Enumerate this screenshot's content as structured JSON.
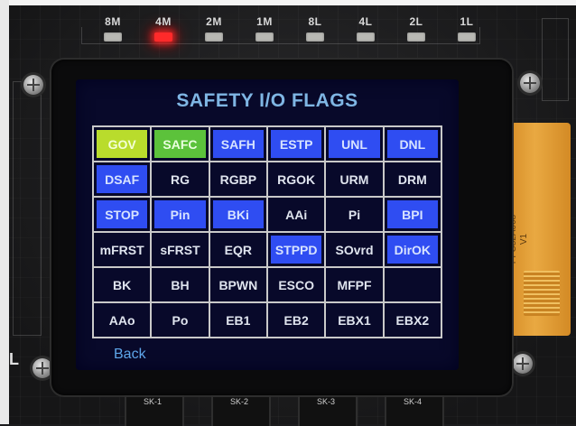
{
  "leds": [
    {
      "label": "8M",
      "on": false
    },
    {
      "label": "4M",
      "on": true
    },
    {
      "label": "2M",
      "on": false
    },
    {
      "label": "1M",
      "on": false
    },
    {
      "label": "8L",
      "on": false
    },
    {
      "label": "4L",
      "on": false
    },
    {
      "label": "2L",
      "on": false
    },
    {
      "label": "1L",
      "on": false
    }
  ],
  "screen": {
    "title": "SAFETY I/O FLAGS",
    "back_label": "Back",
    "flags": [
      [
        {
          "label": "GOV",
          "state": "yellowgreen"
        },
        {
          "label": "SAFC",
          "state": "green"
        },
        {
          "label": "SAFH",
          "state": "blue"
        },
        {
          "label": "ESTP",
          "state": "blue"
        },
        {
          "label": "UNL",
          "state": "blue"
        },
        {
          "label": "DNL",
          "state": "blue"
        }
      ],
      [
        {
          "label": "DSAF",
          "state": "blue"
        },
        {
          "label": "RG",
          "state": "dark"
        },
        {
          "label": "RGBP",
          "state": "dark"
        },
        {
          "label": "RGOK",
          "state": "dark"
        },
        {
          "label": "URM",
          "state": "dark"
        },
        {
          "label": "DRM",
          "state": "dark"
        }
      ],
      [
        {
          "label": "STOP",
          "state": "blue"
        },
        {
          "label": "Pin",
          "state": "blue"
        },
        {
          "label": "BKi",
          "state": "blue"
        },
        {
          "label": "AAi",
          "state": "dark"
        },
        {
          "label": "Pi",
          "state": "dark"
        },
        {
          "label": "BPI",
          "state": "blue"
        }
      ],
      [
        {
          "label": "mFRST",
          "state": "dark"
        },
        {
          "label": "sFRST",
          "state": "dark"
        },
        {
          "label": "EQR",
          "state": "dark"
        },
        {
          "label": "STPPD",
          "state": "blue"
        },
        {
          "label": "SOvrd",
          "state": "dark"
        },
        {
          "label": "DirOK",
          "state": "blue"
        }
      ],
      [
        {
          "label": "BK",
          "state": "dark"
        },
        {
          "label": "BH",
          "state": "dark"
        },
        {
          "label": "BPWN",
          "state": "dark"
        },
        {
          "label": "ESCO",
          "state": "dark"
        },
        {
          "label": "MFPF",
          "state": "dark"
        },
        {
          "label": "",
          "state": "dark"
        }
      ],
      [
        {
          "label": "AAo",
          "state": "dark"
        },
        {
          "label": "Po",
          "state": "dark"
        },
        {
          "label": "EB1",
          "state": "dark"
        },
        {
          "label": "EB2",
          "state": "dark"
        },
        {
          "label": "EBX1",
          "state": "dark"
        },
        {
          "label": "EBX2",
          "state": "dark"
        }
      ]
    ]
  },
  "connectors": [
    "SK-1",
    "SK-2",
    "SK-3",
    "SK-4"
  ],
  "flex_cable_text": "32009 PFC32A008 V1",
  "side_letter": "L",
  "colors": {
    "blue": "#2f4df2",
    "green": "#5cc23b",
    "yellowgreen": "#b9dc2c",
    "led_on": "#ff2a2a",
    "title": "#7fb6e4"
  }
}
